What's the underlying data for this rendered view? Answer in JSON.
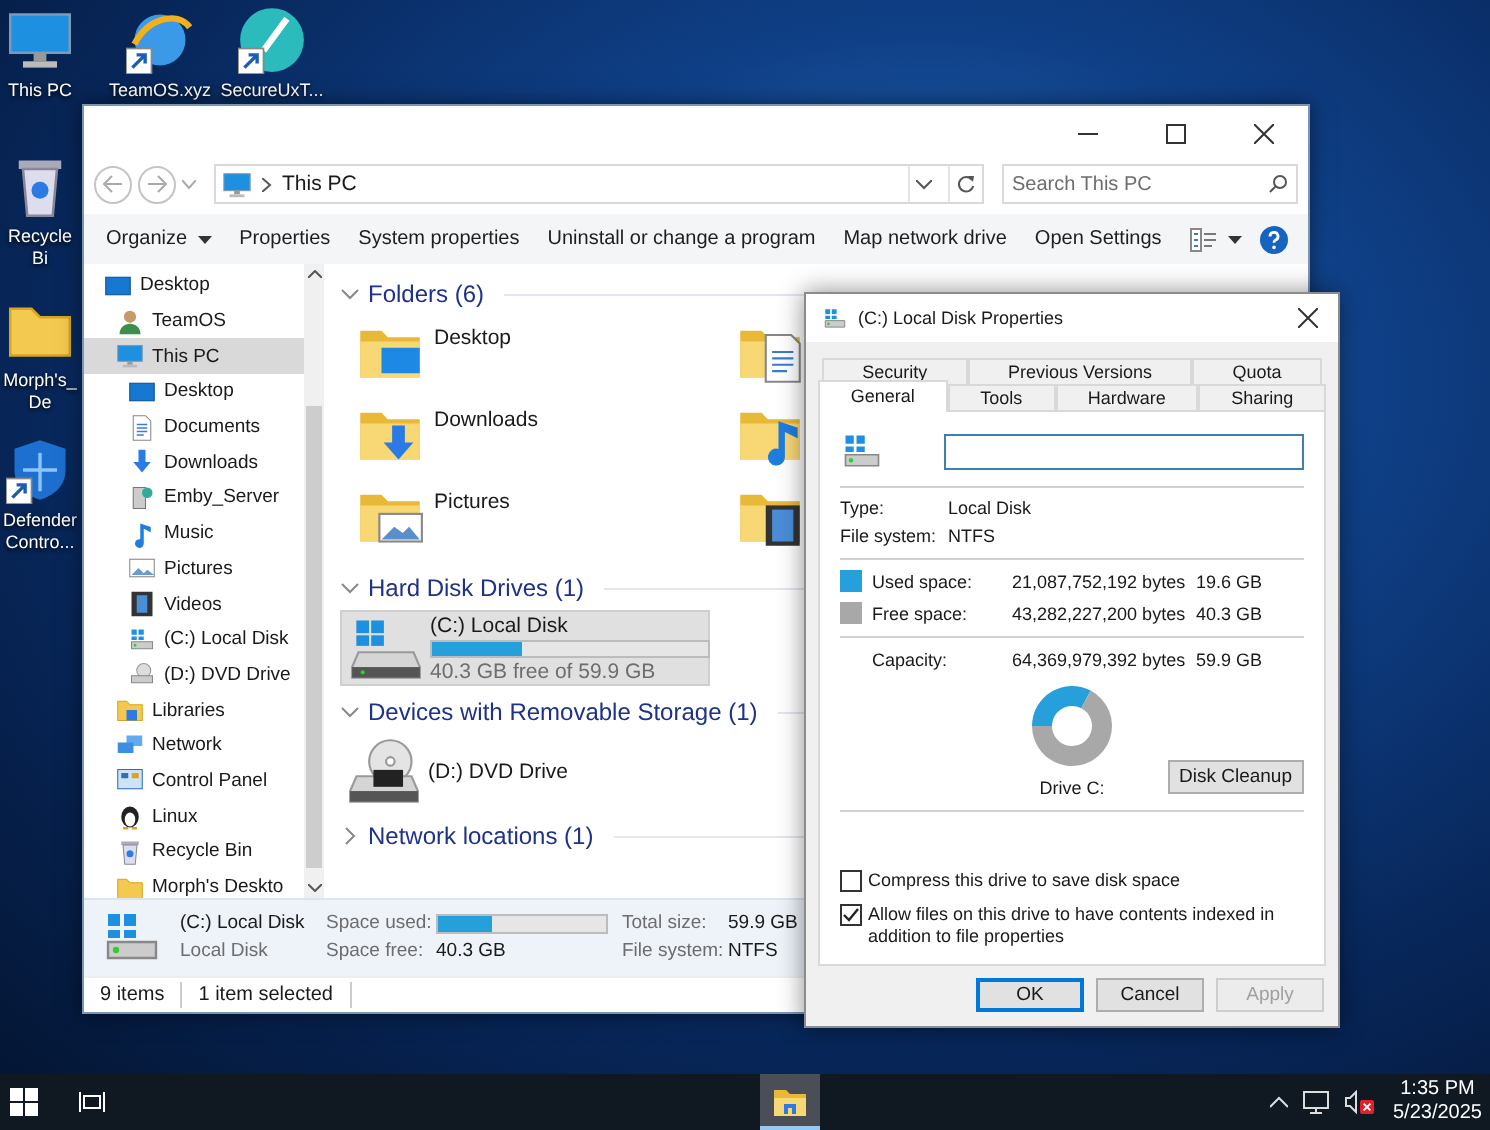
{
  "desktop": {
    "icons": [
      {
        "label": "This PC",
        "kind": "pc",
        "shortcut": false
      },
      {
        "label": "TeamOS.xyz",
        "kind": "globe",
        "shortcut": true
      },
      {
        "label": "SecureUxT...",
        "kind": "pen",
        "shortcut": true
      },
      {
        "label": "Recycle Bi",
        "kind": "recycle-bin",
        "shortcut": false
      },
      {
        "label": "Morph's_De",
        "kind": "folder",
        "shortcut": false
      },
      {
        "label": "Defender Contro...",
        "kind": "shield",
        "shortcut": true
      }
    ]
  },
  "explorer": {
    "address": {
      "path": "This PC"
    },
    "search": {
      "placeholder": "Search This PC"
    },
    "toolbar": [
      {
        "label": "Organize",
        "kind": "menu"
      },
      {
        "label": "Properties",
        "kind": "button"
      },
      {
        "label": "System properties",
        "kind": "button"
      },
      {
        "label": "Uninstall or change a program",
        "kind": "button"
      },
      {
        "label": "Map network drive",
        "kind": "button"
      },
      {
        "label": "Open Settings",
        "kind": "button"
      }
    ],
    "sidebar": {
      "items": [
        {
          "label": "Desktop",
          "kind": "desktop",
          "selected": false,
          "children": [
            {
              "label": "TeamOS",
              "kind": "user",
              "selected": false
            },
            {
              "label": "This PC",
              "kind": "pc",
              "selected": true,
              "children": [
                {
                  "label": "Desktop",
                  "kind": "desktop",
                  "selected": false
                },
                {
                  "label": "Documents",
                  "kind": "documents",
                  "selected": false
                },
                {
                  "label": "Downloads",
                  "kind": "downloads",
                  "selected": false
                },
                {
                  "label": "Emby_Server",
                  "kind": "server",
                  "selected": false
                },
                {
                  "label": "Music",
                  "kind": "music",
                  "selected": false
                },
                {
                  "label": "Pictures",
                  "kind": "pictures",
                  "selected": false
                },
                {
                  "label": "Videos",
                  "kind": "videos",
                  "selected": false
                },
                {
                  "label": "(C:) Local Disk",
                  "kind": "disk",
                  "selected": false
                },
                {
                  "label": "(D:) DVD Drive",
                  "kind": "dvd",
                  "selected": false
                }
              ]
            },
            {
              "label": "Libraries",
              "kind": "libraries",
              "selected": false
            },
            {
              "label": "Network",
              "kind": "network",
              "selected": false
            },
            {
              "label": "Control Panel",
              "kind": "control-panel",
              "selected": false
            },
            {
              "label": "Linux",
              "kind": "linux",
              "selected": false
            },
            {
              "label": "Recycle Bin",
              "kind": "recycle-bin",
              "selected": false
            },
            {
              "label": "Morph's Deskto",
              "kind": "folder",
              "selected": false
            }
          ]
        }
      ]
    },
    "groups": [
      {
        "title": "Folders (6)",
        "kind": "folders",
        "expanded": true,
        "items": [
          {
            "label": "Desktop",
            "kind": "desktop"
          },
          {
            "kind": "documents"
          },
          {
            "label": "Downloads",
            "kind": "downloads"
          },
          {
            "kind": "music"
          },
          {
            "label": "Pictures",
            "kind": "pictures"
          },
          {
            "kind": "videos"
          }
        ]
      },
      {
        "title": "Hard Disk Drives (1)",
        "kind": "drives",
        "expanded": true,
        "items": [
          {
            "label": "(C:) Local Disk",
            "kind": "disk",
            "selected": true,
            "level": 0.327,
            "free": "40.3 GB free of 59.9 GB"
          }
        ]
      },
      {
        "title": "Devices with Removable Storage (1)",
        "kind": "drives",
        "expanded": true,
        "items": [
          {
            "label": "(D:) DVD Drive",
            "kind": "dvd",
            "selected": false
          }
        ]
      },
      {
        "title": "Network locations (1)",
        "kind": "folders",
        "expanded": false
      }
    ],
    "details": {
      "name": "(C:) Local Disk",
      "type": "Local Disk",
      "fields": [
        {
          "label": "Space used:",
          "level": 0.327
        },
        {
          "label": "Space free:",
          "value": "40.3 GB"
        },
        {
          "label": "Total size:",
          "value": "59.9 GB"
        },
        {
          "label": "File system:",
          "value": "NTFS"
        }
      ]
    },
    "status_bar": [
      "9 items",
      "1 item selected"
    ]
  },
  "properties_dialog": {
    "title": "(C:) Local Disk Properties",
    "tab_rows": [
      {
        "tabs": [
          {
            "label": "Security",
            "selected": false
          },
          {
            "label": "Previous Versions",
            "selected": false
          },
          {
            "label": "Quota",
            "selected": false
          }
        ]
      },
      {
        "tabs": [
          {
            "label": "General",
            "selected": true
          },
          {
            "label": "Tools",
            "selected": false
          },
          {
            "label": "Hardware",
            "selected": false
          },
          {
            "label": "Sharing",
            "selected": false
          }
        ]
      }
    ],
    "name_field": {
      "focused": true
    },
    "info": [
      {
        "label": "Type:",
        "value": "Local Disk"
      },
      {
        "label": "File system:",
        "value": "NTFS"
      }
    ],
    "space": [
      {
        "label": "Used space:",
        "bytes": "21,087,752,192 bytes",
        "size": "19.6 GB",
        "color": "#26a0da"
      },
      {
        "label": "Free space:",
        "bytes": "43,282,227,200 bytes",
        "size": "40.3 GB",
        "color": "#a8a8a8"
      }
    ],
    "capacity": {
      "label": "Capacity:",
      "bytes": "64,369,979,392 bytes",
      "size": "59.9 GB"
    },
    "chart_data": {
      "type": "donut",
      "values": [
        32.7,
        67.3
      ]
    },
    "drive_label": "Drive C:",
    "cleanup_button": "Disk Cleanup",
    "options": [
      {
        "label": "Compress this drive to save disk space",
        "checked": false
      },
      {
        "label": "Allow files on this drive to have contents indexed in addition to file properties",
        "checked": true
      }
    ],
    "buttons": [
      {
        "label": "OK",
        "default": true,
        "disabled": false
      },
      {
        "label": "Cancel",
        "default": false,
        "disabled": false
      },
      {
        "label": "Apply",
        "default": false,
        "disabled": true
      }
    ]
  },
  "taskbar": {
    "apps": [
      {
        "kind": "file-explorer",
        "active": true
      }
    ],
    "clock": {
      "time": "1:35 PM",
      "date": "5/23/2025"
    }
  }
}
